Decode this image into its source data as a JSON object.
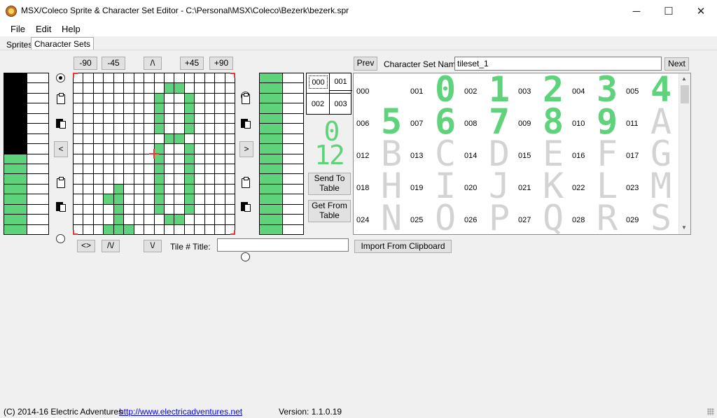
{
  "window": {
    "title": "MSX/Coleco Sprite & Character Set Editor - C:\\Personal\\MSX\\Coleco\\Bezerk\\bezerk.spr",
    "minimize_glyph": "─",
    "maximize_glyph": "☐",
    "close_glyph": "✕"
  },
  "menu": [
    "File",
    "Edit",
    "Help"
  ],
  "tabs": [
    "Sprites",
    "Character Sets"
  ],
  "toolbar": {
    "rot_minus90": "-90",
    "rot_minus45": "-45",
    "up": "/\\",
    "rot_plus45": "+45",
    "rot_plus90": "+90",
    "mirror": "<>",
    "flip": "/\\/",
    "down": "\\/",
    "shift_left": "<",
    "shift_right": ">"
  },
  "tile_title": {
    "label": "Tile # Title:",
    "value": ""
  },
  "tile_selector": [
    "000",
    "001",
    "002",
    "003"
  ],
  "preview_digits": {
    "top": "0",
    "bottom": "12"
  },
  "buttons": {
    "send_to_table": "Send To Table",
    "get_from_table": "Get From Table",
    "import_from_clipboard": "Import From Clipboard",
    "prev": "Prev",
    "next": "Next"
  },
  "charset": {
    "name_label": "Character Set Name",
    "name_value": "tileset_1",
    "rows": [
      [
        [
          "000",
          ""
        ],
        [
          "001",
          "0"
        ],
        [
          "002",
          "1"
        ],
        [
          "003",
          "2"
        ],
        [
          "004",
          "3"
        ],
        [
          "005",
          "4"
        ]
      ],
      [
        [
          "006",
          "5"
        ],
        [
          "007",
          "6"
        ],
        [
          "008",
          "7"
        ],
        [
          "009",
          "8"
        ],
        [
          "010",
          "9"
        ],
        [
          "011",
          "A"
        ]
      ],
      [
        [
          "012",
          "B"
        ],
        [
          "013",
          "C"
        ],
        [
          "014",
          "D"
        ],
        [
          "015",
          "E"
        ],
        [
          "016",
          "F"
        ],
        [
          "017",
          "G"
        ]
      ],
      [
        [
          "018",
          "H"
        ],
        [
          "019",
          "I"
        ],
        [
          "020",
          "J"
        ],
        [
          "021",
          "K"
        ],
        [
          "022",
          "L"
        ],
        [
          "023",
          "M"
        ]
      ],
      [
        [
          "024",
          "N"
        ],
        [
          "025",
          "O"
        ],
        [
          "026",
          "P"
        ],
        [
          "027",
          "Q"
        ],
        [
          "028",
          "R"
        ],
        [
          "029",
          "S"
        ]
      ]
    ],
    "green_glyphs": [
      "0",
      "1",
      "2",
      "3",
      "4",
      "5",
      "6",
      "7",
      "8",
      "9"
    ]
  },
  "status": {
    "copyright": "(C) 2014-16 Electric Adventures",
    "url": "http://www.electricadventures.net",
    "version": "Version: 1.1.0.19"
  },
  "colors": {
    "pixel_on": "#5fd37b",
    "glyph_inactive": "#d3d3d3",
    "link": "#0000ee",
    "corner_marker": "#e53935"
  },
  "editor_pixels": [
    "0000000000000000",
    "0000000001100000",
    "0000000010010000",
    "0000000010010000",
    "0000000010010000",
    "0000000010010000",
    "0000000001100000",
    "0000000010010000",
    "0000000010010000",
    "0000000010010000",
    "0000000010010000",
    "0000100010010000",
    "0001100010010000",
    "0000100010010000",
    "0000100001100000",
    "0001110000000000"
  ],
  "left_color_column": [
    "K",
    "K",
    "K",
    "K",
    "K",
    "K",
    "K",
    "K",
    "G",
    "G",
    "G",
    "G",
    "G",
    "G",
    "G",
    "G"
  ],
  "right_color_column": [
    "G",
    "G",
    "G",
    "G",
    "G",
    "G",
    "G",
    "G",
    "G",
    "G",
    "G",
    "G",
    "G",
    "G",
    "G",
    "G"
  ]
}
